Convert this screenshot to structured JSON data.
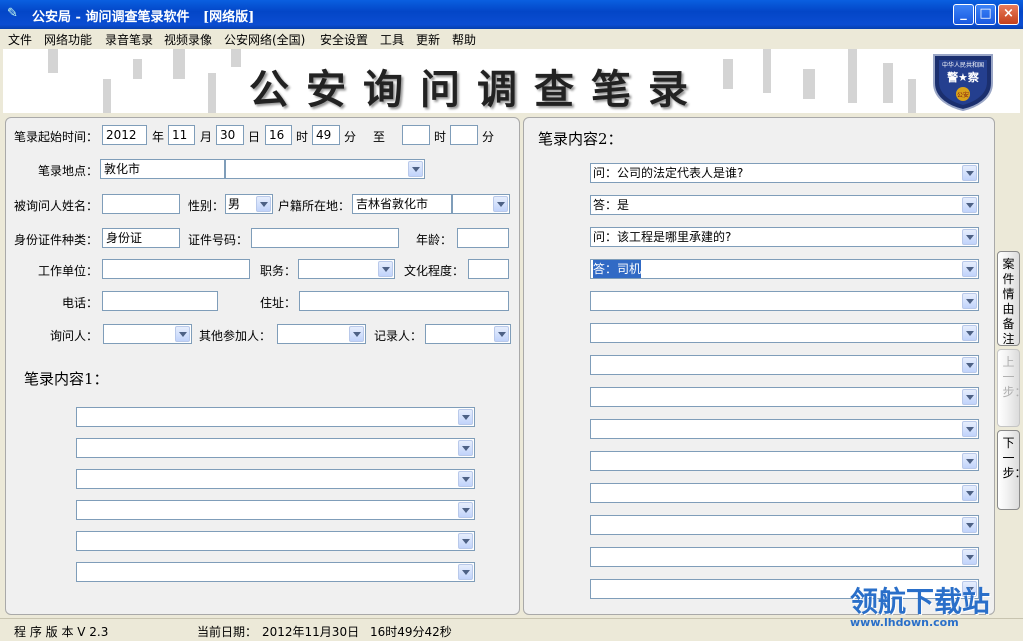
{
  "window": {
    "title": "公安局 - 询问调查笔录软件   [网络版]",
    "minimize": "_",
    "maximize": "□",
    "close": "×"
  },
  "menu": [
    "文件",
    "网络功能",
    "录音笔录",
    "视频录像",
    "公安网络(全国)",
    "安全设置",
    "工具",
    "更新",
    "帮助"
  ],
  "banner": {
    "title": "公安询问调查笔录",
    "badge_top": "中华人民共和国",
    "badge_main": "警★察",
    "badge_bottom": "公安"
  },
  "form": {
    "start_time_label": "笔录起始时间：",
    "year": "2012",
    "year_unit": "年",
    "month": "11",
    "month_unit": "月",
    "day": "30",
    "day_unit": "日",
    "hour": "16",
    "hour_unit": "时",
    "minute": "49",
    "minute_unit": "分",
    "to_label": "至",
    "end_hour": "",
    "end_hour_unit": "时",
    "end_minute": "",
    "end_minute_unit": "分",
    "location_label": "笔录地点：",
    "location": "敦化市",
    "location_detail": "",
    "name_label": "被询问人姓名：",
    "name": "",
    "gender_label": "性别：",
    "gender": "男",
    "hukou_label": "户籍所在地：",
    "hukou": "吉林省敦化市",
    "hukou_detail": "",
    "id_type_label": "身份证件种类：",
    "id_type": "身份证",
    "id_no_label": "证件号码：",
    "id_no": "",
    "age_label": "年龄：",
    "age": "",
    "employer_label": "工作单位：",
    "employer": "",
    "position_label": "职务：",
    "position": "",
    "education_label": "文化程度：",
    "education": "",
    "phone_label": "电话：",
    "phone": "",
    "address_label": "住址：",
    "address": "",
    "interviewer_label": "询问人：",
    "interviewer": "",
    "others_label": "其他参加人：",
    "others": "",
    "recorder_label": "记录人：",
    "recorder": ""
  },
  "content1": {
    "title": "笔录内容1：",
    "lines": [
      "",
      "",
      "",
      "",
      "",
      ""
    ]
  },
  "content2": {
    "title": "笔录内容2：",
    "lines": [
      "问：公司的法定代表人是谁?",
      "答：是",
      "问：该工程是哪里承建的?",
      "答：司机",
      "",
      "",
      "",
      "",
      "",
      "",
      "",
      "",
      "",
      ""
    ]
  },
  "side_buttons": {
    "case_note": "案件情由备注",
    "prev": "上一步：",
    "next": "下一步："
  },
  "status": {
    "version": "程 序 版 本 V 2.3",
    "date_label": "当前日期：",
    "date": "2012年11月30日",
    "time": "16时49分42秒"
  },
  "watermark": {
    "main": "领航下载站",
    "url": "www.lhdown.com"
  },
  "colors": {
    "titlebar": "#0346c7",
    "selection": "#316ac5",
    "watermark": "#2a6fc9"
  }
}
